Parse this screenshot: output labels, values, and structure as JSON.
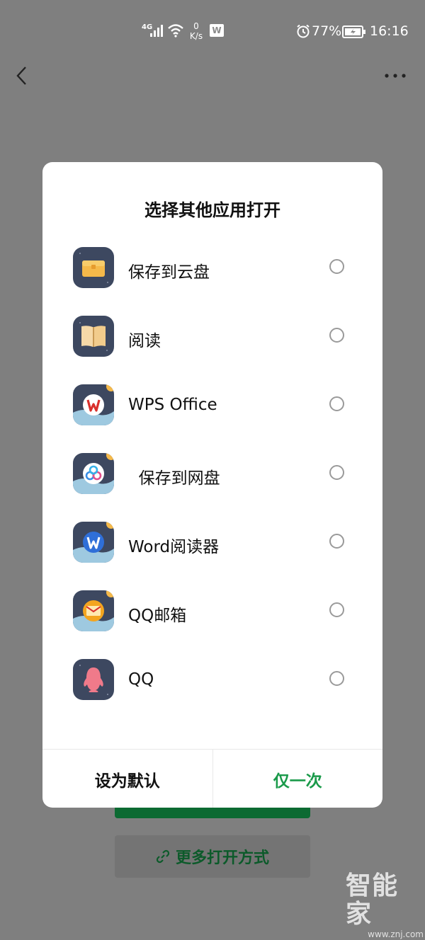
{
  "status_bar": {
    "network": "4G",
    "speed_value": "0",
    "speed_unit": "K/s",
    "wps_badge": "W",
    "battery_percent": "77%",
    "time": "16:16"
  },
  "dialog": {
    "title": "选择其他应用打开",
    "apps": [
      {
        "label": "保存到云盘",
        "icon": "cloud-drive-icon"
      },
      {
        "label": "阅读",
        "icon": "book-reader-icon"
      },
      {
        "label": "WPS Office",
        "icon": "wps-office-icon"
      },
      {
        "label": "  保存到网盘",
        "icon": "baidu-netdisk-icon"
      },
      {
        "label": "Word阅读器",
        "icon": "word-reader-icon"
      },
      {
        "label": "QQ邮箱",
        "icon": "qq-mail-icon"
      },
      {
        "label": "QQ",
        "icon": "qq-icon"
      }
    ],
    "set_default_label": "设为默认",
    "once_label": "仅一次"
  },
  "background": {
    "more_open_label": "更多打开方式"
  },
  "watermark": {
    "brand": "智能家",
    "url": "www.znj.com"
  },
  "colors": {
    "overlay": "#7f7f7f",
    "accent_green": "#1a9a4a",
    "icon_dark": "#3d4860"
  }
}
